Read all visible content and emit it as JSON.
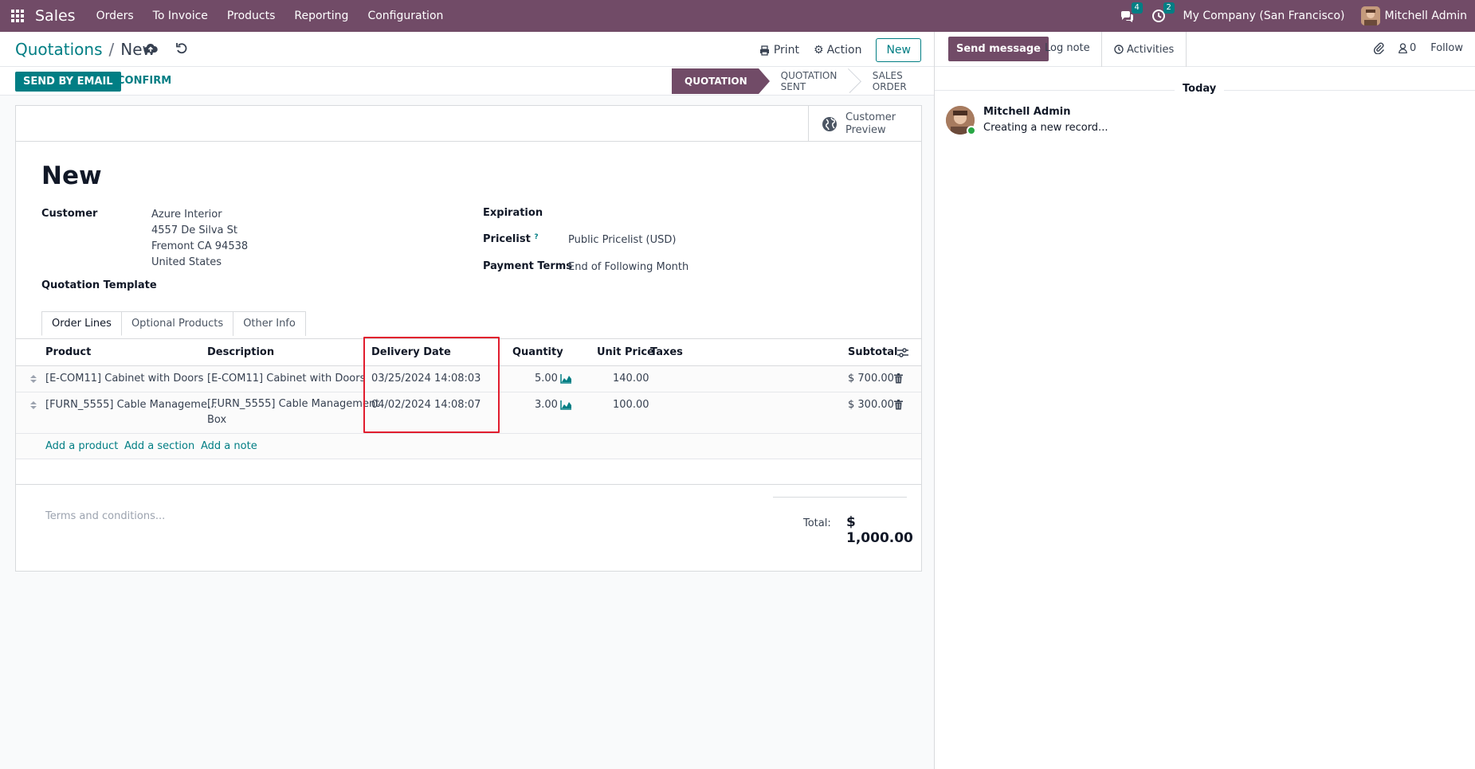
{
  "navbar": {
    "app_name": "Sales",
    "menu": [
      "Orders",
      "To Invoice",
      "Products",
      "Reporting",
      "Configuration"
    ],
    "messages_count": "4",
    "activities_count": "2",
    "company": "My Company (San Francisco)",
    "user": "Mitchell Admin"
  },
  "breadcrumb": {
    "parent": "Quotations",
    "separator": "/",
    "current": "New"
  },
  "control_panel": {
    "print": "Print",
    "action": "Action",
    "new": "New"
  },
  "statusbar": {
    "send_by_email": "SEND BY EMAIL",
    "confirm": "CONFIRM",
    "stages": [
      "QUOTATION",
      "QUOTATION SENT",
      "SALES ORDER"
    ],
    "active_stage": "QUOTATION"
  },
  "form": {
    "customer_preview": [
      "Customer",
      "Preview"
    ],
    "title": "New",
    "customer_label": "Customer",
    "customer_address": [
      "Azure Interior",
      "4557 De Silva St",
      "Fremont CA 94538",
      "United States"
    ],
    "quotation_template_label": "Quotation Template",
    "expiration_label": "Expiration",
    "pricelist_label": "Pricelist",
    "pricelist_help": "?",
    "pricelist_value": "Public Pricelist (USD)",
    "payment_terms_label": "Payment Terms",
    "payment_terms_value": "End of Following Month"
  },
  "tabs": [
    "Order Lines",
    "Optional Products",
    "Other Info"
  ],
  "order_lines": {
    "columns": [
      "Product",
      "Description",
      "Delivery Date",
      "Quantity",
      "Unit Price",
      "Taxes",
      "Subtotal"
    ],
    "rows": [
      {
        "product": "[E-COM11] Cabinet with Doors",
        "description": "[E-COM11] Cabinet with Doors",
        "description2": "",
        "delivery_date": "03/25/2024 14:08:03",
        "quantity": "5.00",
        "unit_price": "140.00",
        "taxes": "",
        "subtotal": "$ 700.00"
      },
      {
        "product": "[FURN_5555] Cable Manageme...",
        "description": "[FURN_5555] Cable Management",
        "description2": "Box",
        "delivery_date": "04/02/2024 14:08:07",
        "quantity": "3.00",
        "unit_price": "100.00",
        "taxes": "",
        "subtotal": "$ 300.00"
      }
    ],
    "add_product": "Add a product",
    "add_section": "Add a section",
    "add_note": "Add a note"
  },
  "terms_placeholder": "Terms and conditions...",
  "totals": {
    "label": "Total:",
    "value": "$ 1,000.00"
  },
  "chatter": {
    "send_message": "Send message",
    "log_note": "Log note",
    "activities": "Activities",
    "followers_count": "0",
    "follow": "Follow",
    "date_separator": "Today",
    "message_author": "Mitchell Admin",
    "message_body": "Creating a new record..."
  },
  "colors": {
    "brand": "#714b67",
    "accent": "#017e84",
    "highlight": "#e11d2e"
  }
}
